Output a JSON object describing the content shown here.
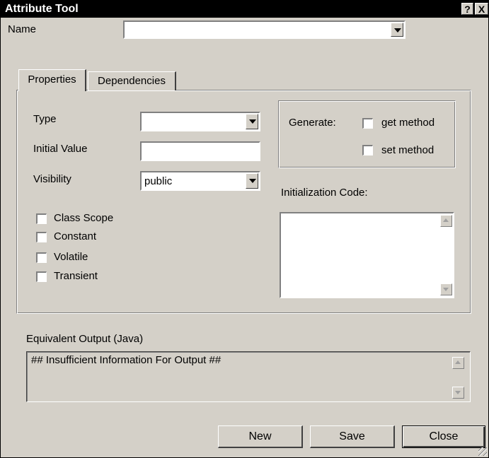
{
  "window": {
    "title": "Attribute Tool",
    "help_glyph": "?",
    "close_glyph": "X"
  },
  "name_field": {
    "label": "Name",
    "value": ""
  },
  "tabs": [
    {
      "label": "Properties",
      "active": true
    },
    {
      "label": "Dependencies",
      "active": false
    }
  ],
  "properties": {
    "type": {
      "label": "Type",
      "value": ""
    },
    "initial_value": {
      "label": "Initial Value",
      "value": ""
    },
    "visibility": {
      "label": "Visibility",
      "value": "public"
    },
    "checkboxes": [
      {
        "label": "Class Scope",
        "checked": false
      },
      {
        "label": "Constant",
        "checked": false
      },
      {
        "label": "Volatile",
        "checked": false
      },
      {
        "label": "Transient",
        "checked": false
      }
    ],
    "generate": {
      "label": "Generate:",
      "get_method": {
        "label": "get method",
        "checked": false
      },
      "set_method": {
        "label": "set method",
        "checked": false
      }
    },
    "initialization_code": {
      "label": "Initialization Code:",
      "value": ""
    }
  },
  "output": {
    "label": "Equivalent Output (Java)",
    "text": "## Insufficient Information For Output ##"
  },
  "buttons": {
    "new": "New",
    "save": "Save",
    "close": "Close"
  }
}
